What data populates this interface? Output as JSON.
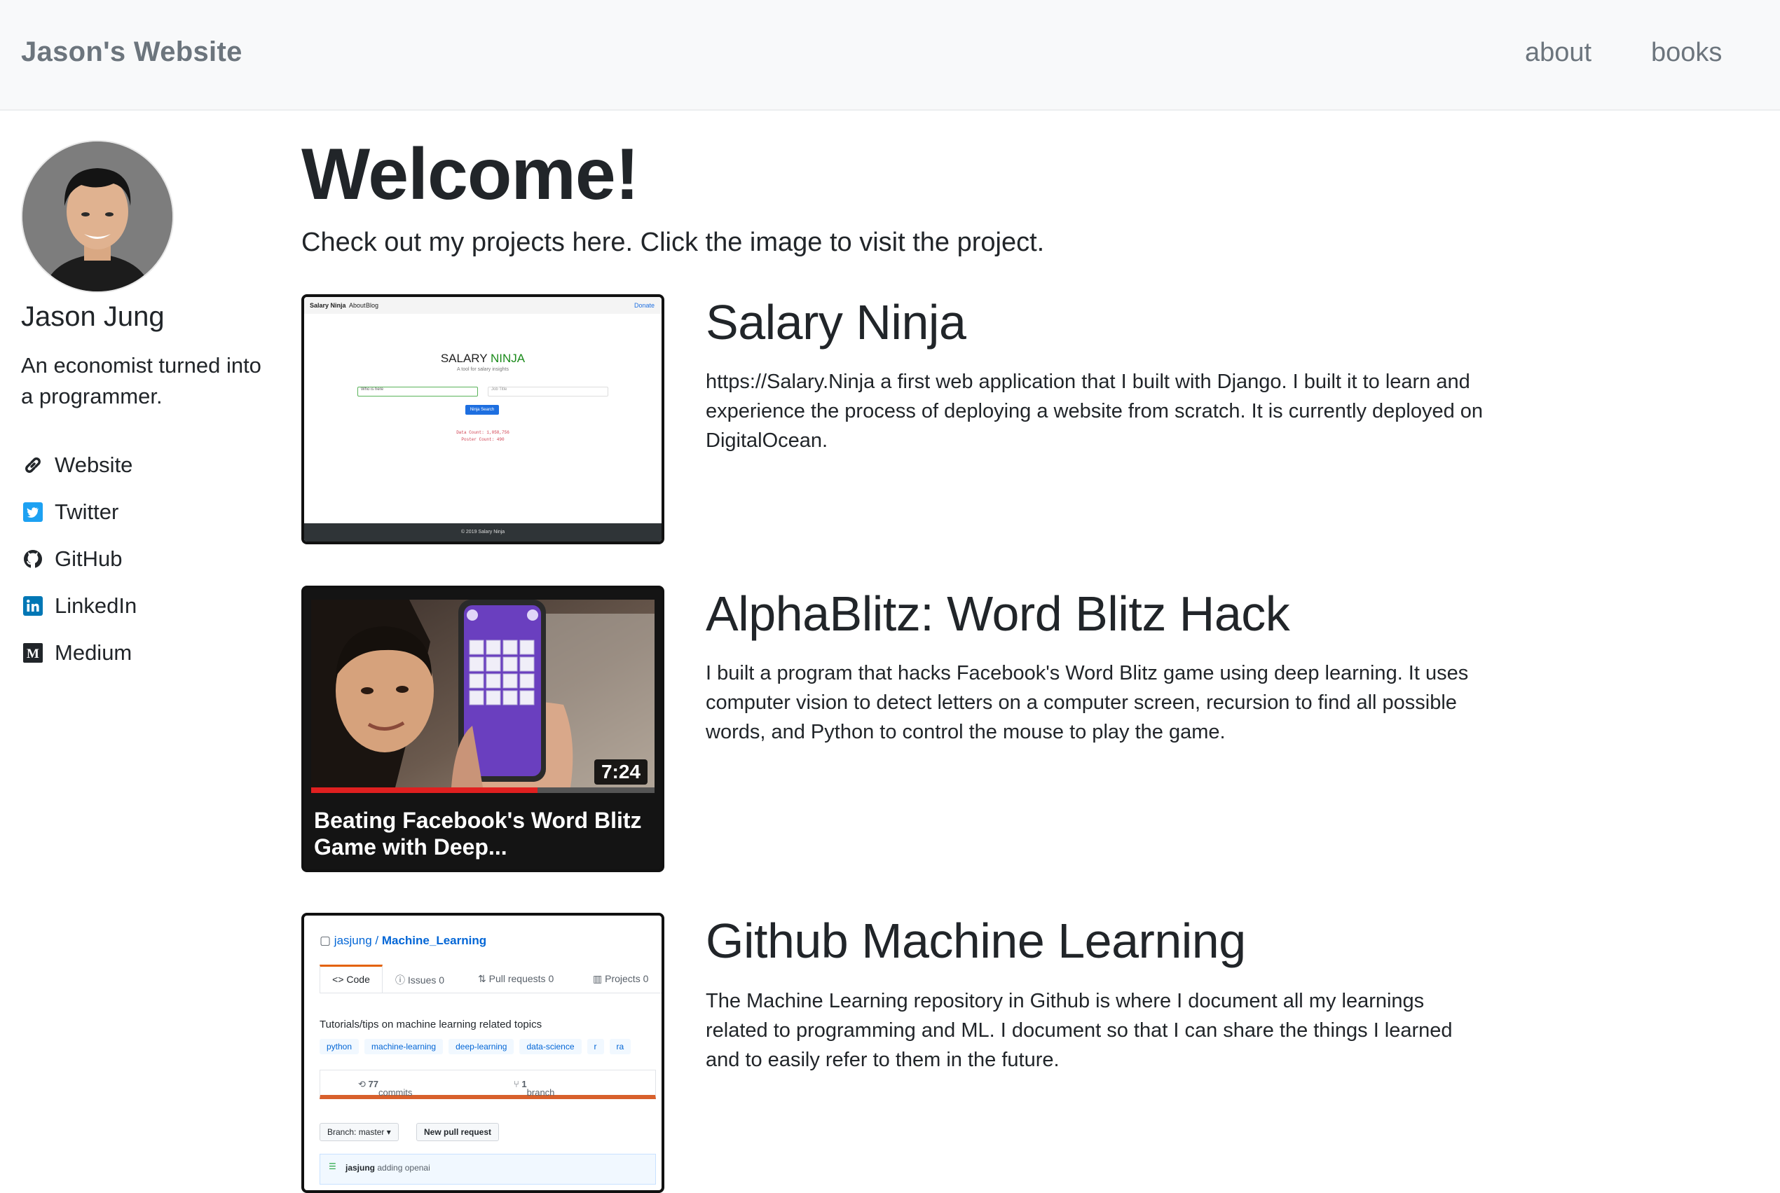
{
  "navbar": {
    "brand": "Jason's Website",
    "links": [
      {
        "label": "about"
      },
      {
        "label": "books"
      }
    ]
  },
  "sidebar": {
    "name": "Jason Jung",
    "bio": "An economist turned into a programmer.",
    "links": [
      {
        "label": "Website",
        "icon": "link-icon"
      },
      {
        "label": "Twitter",
        "icon": "twitter-icon",
        "color": "#1da1f2"
      },
      {
        "label": "GitHub",
        "icon": "github-icon"
      },
      {
        "label": "LinkedIn",
        "icon": "linkedin-icon",
        "color": "#0077b5"
      },
      {
        "label": "Medium",
        "icon": "medium-icon"
      }
    ]
  },
  "main": {
    "title": "Welcome!",
    "intro": "Check out my projects here. Click the image to visit the project.",
    "projects": [
      {
        "title": "Salary Ninja",
        "description": "https://Salary.Ninja a first web application that I built with Django. I built it to learn and experience the process of deploying a website from scratch. It is currently deployed on DigitalOcean.",
        "thumbnail": {
          "nav_brand": "Salary Ninja",
          "nav_about": "About",
          "nav_blog": "Blog",
          "nav_donate": "Donate",
          "headline_a": "SALARY ",
          "headline_b": "NINJA",
          "tagline": "A tool for salary insights",
          "input1": "Who is here",
          "input2": "Job Title",
          "button": "Ninja Search",
          "stat1": "Data Count: 1,058,756",
          "stat2": "Poster Count: 490",
          "footer": "© 2019 Salary Ninja"
        }
      },
      {
        "title": "AlphaBlitz: Word Blitz Hack",
        "description": "I built a program that hacks Facebook's Word Blitz game using deep learning. It uses computer vision to detect letters on a computer screen, recursion to find all possible words, and Python to control the mouse to play the game.",
        "thumbnail": {
          "duration": "7:24",
          "caption": "Beating Facebook's Word Blitz Game with Deep...",
          "progress": 0.66
        }
      },
      {
        "title": "Github Machine Learning",
        "description": "The Machine Learning repository in Github is where I document all my learnings related to programming and ML. I document so that I can share the things I learned and to easily refer to them in the future.",
        "thumbnail": {
          "owner": "jasjung",
          "repo": "Machine_Learning",
          "tabs": [
            "Code",
            "Issues",
            "Pull requests",
            "Projects"
          ],
          "issues_count": "0",
          "pr_count": "0",
          "projects_count": "0",
          "topic_description": "Tutorials/tips on machine learning related topics",
          "tags": [
            "python",
            "machine-learning",
            "deep-learning",
            "data-science",
            "r",
            "ra"
          ],
          "commits": "77",
          "commits_label": "commits",
          "branches": "1",
          "branches_label": "branch",
          "branch_button": "Branch: master ▾",
          "new_pr_button": "New pull request",
          "commit_author": "jasjung",
          "commit_message": "adding openai"
        }
      }
    ]
  }
}
